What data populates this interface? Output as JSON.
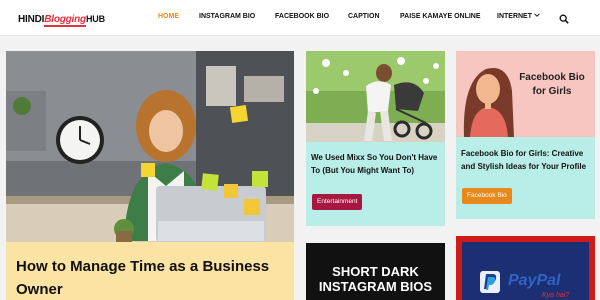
{
  "site": {
    "logo_part1": "HINDI",
    "logo_part2": "Blogging",
    "logo_part3": "HUB"
  },
  "nav": {
    "items": [
      {
        "label": "HOME",
        "active": true
      },
      {
        "label": "INSTAGRAM BIO"
      },
      {
        "label": "FACEBOOK BIO"
      },
      {
        "label": "CAPTION"
      },
      {
        "label": "PAISE KAMAYE ONLINE"
      },
      {
        "label": "INTERNET",
        "has_dropdown": true
      }
    ],
    "dropdown_icon": "chevron-down-icon",
    "search_icon": "search-icon",
    "active_color": "#e8891c"
  },
  "posts": {
    "main": {
      "title": "How to Manage Time as a Business Owner",
      "background": "#fbe3a3"
    },
    "mixx": {
      "title": "We Used Mixx So You Don't Have To (But You Might Want To)",
      "category": "Entertainment",
      "background": "#b9eee8"
    },
    "facebook_bio": {
      "image_text": "Facebook Bio for Girls",
      "title": "Facebook Bio for Girls: Creative and Stylish Ideas for Your Profile",
      "category": "Facebook Bio",
      "background": "#b9eee8"
    },
    "dark_bio": {
      "image_text": "SHORT DARK INSTAGRAM BIOS"
    },
    "paypal": {
      "image_text": "PayPal",
      "image_subtext": "Kya hai?"
    }
  }
}
